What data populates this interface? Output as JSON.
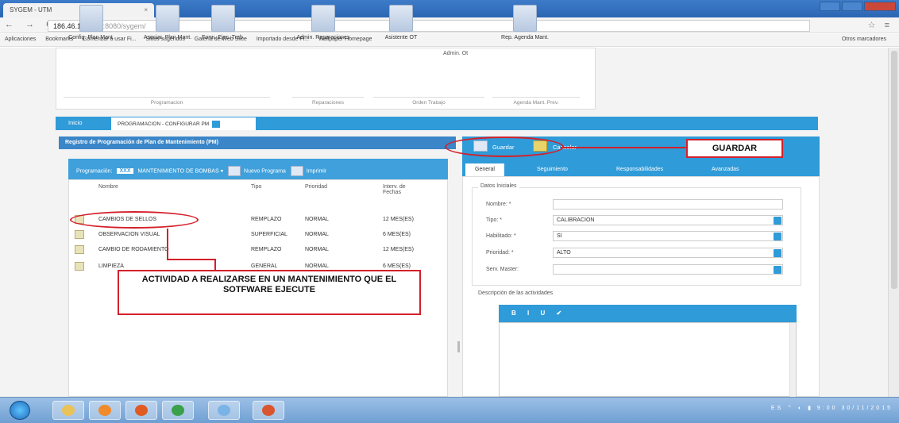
{
  "browser": {
    "tab_title": "SYGEM - UTM",
    "tab_close": "×",
    "nav_glyphs": "← → C",
    "url_host": "186.46.160.249",
    "url_rest": ":8080/sygem/",
    "right_icons": "☆ ≡",
    "bookmarks": [
      "Aplicaciones",
      "Bookmarks",
      "Comenzar a usar Fi...",
      "Sitios sugeridos",
      "Galería de Web Slice",
      "Importado desde Fi...",
      "Wallpaper Homepage"
    ],
    "other_bookmarks": "Otros marcadores"
  },
  "ribbon": {
    "buttons": [
      "Config. Plan Mant.",
      "Asociar. Plan Mant.",
      "Form. Ejec. Trab.",
      "Admin. Reparaciones",
      "Asistente OT",
      "Rep. Agenda Mant."
    ],
    "admin_ot": "Admin. Ot",
    "groups": [
      "Programacion",
      "Reparaciones",
      "Orden Trabajo",
      "Agenda Mant. Prev."
    ]
  },
  "tabs": {
    "inicio": "Inicio",
    "current": "PROGRAMACION - CONFIGURAR PM"
  },
  "left_panel": {
    "title": "Registro de Programación de Plan de Mantenimiento (PM)",
    "programacion_label": "Programación:",
    "chip": "XXX",
    "programacion_value": "MANTENIMIENTO DE BOMBAS",
    "nuevo_programa": "Nuevo Programa",
    "imprimir": "Imprimir",
    "columns": [
      "Nombre",
      "Tipo",
      "Prioridad",
      "Interv. de Fechas"
    ],
    "rows": [
      {
        "nombre": "CAMBIOS DE SELLOS",
        "tipo": "REMPLAZO",
        "prioridad": "NORMAL",
        "intervalo": "12 MES(ES)"
      },
      {
        "nombre": "OBSERVACION VISUAL",
        "tipo": "SUPERFICIAL",
        "prioridad": "NORMAL",
        "intervalo": "6 MES(ES)"
      },
      {
        "nombre": "CAMBIO DE RODAMIENTO",
        "tipo": "REMPLAZO",
        "prioridad": "NORMAL",
        "intervalo": "12 MES(ES)"
      },
      {
        "nombre": "LIMPIEZA",
        "tipo": "GENERAL",
        "prioridad": "NORMAL",
        "intervalo": "6 MES(ES)"
      }
    ]
  },
  "right_panel": {
    "guardar": "Guardar",
    "cancelar": "Cancelar",
    "tabs": [
      "General",
      "Seguimiento",
      "Responsabilidades",
      "Avanzadas"
    ],
    "fieldset_title": "Datos Iniciales",
    "fields": [
      {
        "label": "Nombre: *",
        "value": ""
      },
      {
        "label": "Tipo: *",
        "value": "CALIBRACION"
      },
      {
        "label": "Habilitado: *",
        "value": "SI"
      },
      {
        "label": "Prioridad: *",
        "value": "ALTO"
      },
      {
        "label": "Serv. Master:",
        "value": ""
      }
    ],
    "description_title": "Descripción de las actividades",
    "editor_tools": "B I U ✔"
  },
  "annotations": {
    "guardar": "GUARDAR",
    "actividad": "ACTIVIDAD A REALIZARSE EN UN MANTENIMIENTO QUE EL SOTFWARE EJECUTE"
  },
  "taskbar": {
    "tray": "ES ⌃ ◐ ▮ 9:00 30/11/2015"
  },
  "colors": {
    "accent_blue": "#2f9bd8",
    "annotation_red": "#d4202a"
  }
}
